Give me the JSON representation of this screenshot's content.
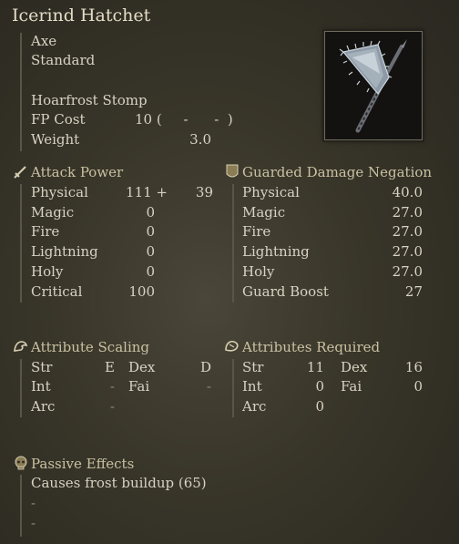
{
  "weapon": {
    "name": "Icerind Hatchet",
    "type": "Axe",
    "affinity": "Standard",
    "skill": "Hoarfrost Stomp",
    "fp_label": "FP Cost",
    "fp_value": "10 (     -      -  )",
    "weight_label": "Weight",
    "weight_value": "3.0",
    "image_icon": "icerind-hatchet-icon"
  },
  "attack_power": {
    "header": "Attack Power",
    "icon": "sword-icon",
    "rows": [
      {
        "label": "Physical",
        "value": "111 +",
        "extra": "39"
      },
      {
        "label": "Magic",
        "value": "0",
        "extra": ""
      },
      {
        "label": "Fire",
        "value": "0",
        "extra": ""
      },
      {
        "label": "Lightning",
        "value": "0",
        "extra": ""
      },
      {
        "label": "Holy",
        "value": "0",
        "extra": ""
      },
      {
        "label": "Critical",
        "value": "100",
        "extra": ""
      }
    ]
  },
  "guard": {
    "header": "Guarded Damage Negation",
    "icon": "shield-icon",
    "rows": [
      {
        "label": "Physical",
        "value": "40.0"
      },
      {
        "label": "Magic",
        "value": "27.0"
      },
      {
        "label": "Fire",
        "value": "27.0"
      },
      {
        "label": "Lightning",
        "value": "27.0"
      },
      {
        "label": "Holy",
        "value": "27.0"
      },
      {
        "label": "Guard Boost",
        "value": "27"
      }
    ]
  },
  "scaling": {
    "header": "Attribute Scaling",
    "icon": "arm-icon",
    "str_label": "Str",
    "str_value": "E",
    "dex_label": "Dex",
    "dex_value": "D",
    "int_label": "Int",
    "int_value": "-",
    "fai_label": "Fai",
    "fai_value": "-",
    "arc_label": "Arc",
    "arc_value": "-"
  },
  "required": {
    "header": "Attributes Required",
    "icon": "hand-icon",
    "str_label": "Str",
    "str_value": "11",
    "dex_label": "Dex",
    "dex_value": "16",
    "int_label": "Int",
    "int_value": "0",
    "fai_label": "Fai",
    "fai_value": "0",
    "arc_label": "Arc",
    "arc_value": "0"
  },
  "passive": {
    "header": "Passive Effects",
    "icon": "skull-icon",
    "lines": [
      "Causes frost buildup (65)",
      "-",
      "-"
    ]
  },
  "colors": {
    "background": "#383529",
    "text": "#d8d3c2",
    "header": "#c9c1a2"
  }
}
